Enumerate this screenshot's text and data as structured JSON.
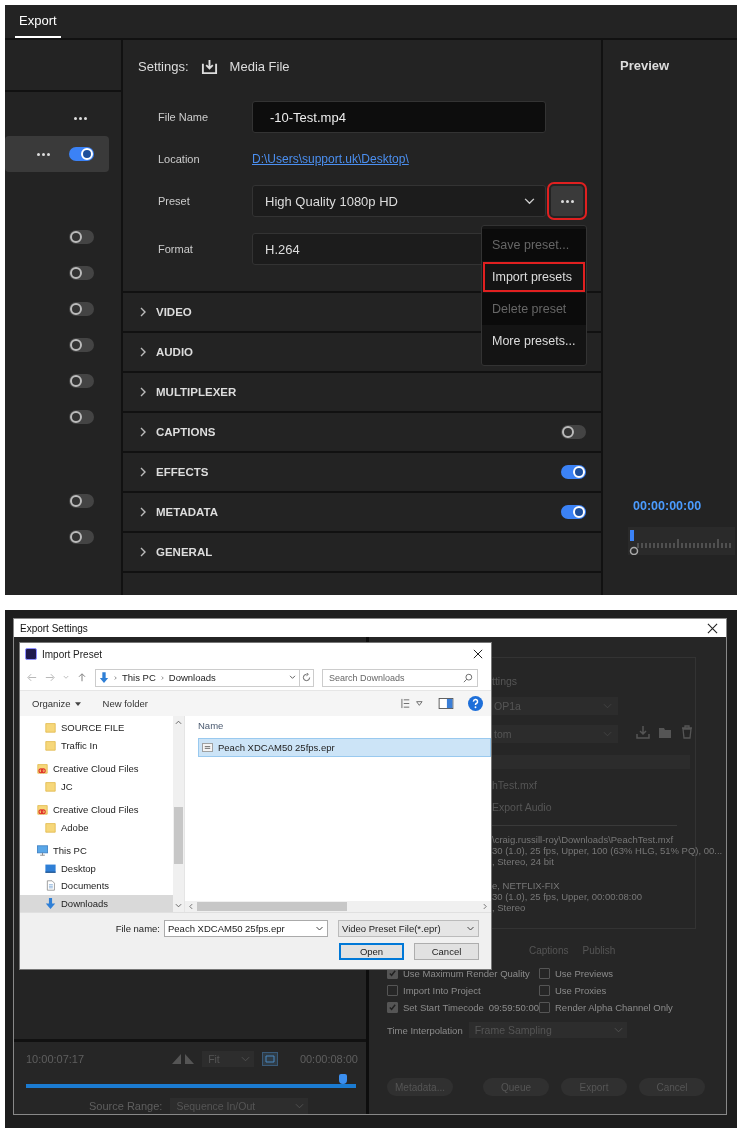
{
  "export_panel": {
    "tabs": [
      {
        "label": "Export",
        "selected": true
      }
    ],
    "targets_top": [
      {
        "kind": "menu",
        "selected": false
      },
      {
        "kind": "menu-toggle",
        "selected": true,
        "on": true
      },
      {
        "kind": "toggle",
        "selected": false,
        "on": false
      },
      {
        "kind": "toggle",
        "selected": false,
        "on": false
      },
      {
        "kind": "toggle",
        "selected": false,
        "on": false
      },
      {
        "kind": "toggle",
        "selected": false,
        "on": false
      },
      {
        "kind": "toggle",
        "selected": false,
        "on": false
      },
      {
        "kind": "toggle",
        "selected": false,
        "on": false
      }
    ],
    "targets_bottom": [
      {
        "kind": "toggle",
        "selected": false,
        "on": false
      },
      {
        "kind": "toggle",
        "selected": false,
        "on": false
      }
    ],
    "settings": {
      "label": "Settings:",
      "destination": "Media File"
    },
    "fields": [
      {
        "kind": "input",
        "label": "File Name",
        "value": "-10-Test.mp4"
      },
      {
        "kind": "link",
        "label": "Location",
        "value": "D:\\Users\\support.uk\\Desktop\\"
      },
      {
        "kind": "select-more",
        "label": "Preset",
        "value": "High Quality 1080p HD",
        "more_highlighted": true
      },
      {
        "kind": "select",
        "label": "Format",
        "value": "H.264"
      }
    ],
    "preset_menu": [
      {
        "label": "Save preset...",
        "disabled": true,
        "highlighted": false
      },
      {
        "label": "Import presets",
        "disabled": false,
        "highlighted": true
      },
      {
        "label": "Delete preset",
        "disabled": true,
        "highlighted": false
      },
      {
        "label": "More presets...",
        "disabled": false,
        "highlighted": false
      }
    ],
    "sections": [
      {
        "label": "VIDEO",
        "kind": "plain"
      },
      {
        "label": "AUDIO",
        "kind": "plain"
      },
      {
        "label": "MULTIPLEXER",
        "kind": "plain"
      },
      {
        "label": "CAPTIONS",
        "kind": "toggle",
        "on": false
      },
      {
        "label": "EFFECTS",
        "kind": "toggle",
        "on": true
      },
      {
        "label": "METADATA",
        "kind": "toggle",
        "on": true
      },
      {
        "label": "GENERAL",
        "kind": "plain"
      }
    ],
    "preview": {
      "title": "Preview",
      "timecode": "00:00:00:00"
    }
  },
  "export_settings_window": {
    "title": "Export Settings",
    "fragments": [
      "ttings",
      "OP1a",
      "tom",
      "hTest.mxf",
      "Export Audio"
    ],
    "summary_lines": [
      "\\craig.russill-roy\\Downloads\\PeachTest.mxf",
      "30 (1.0), 25 fps, Upper, 100 (63% HLG, 51% PQ), 00...",
      ", Stereo, 24 bit",
      "e, NETFLIX-FIX",
      "30 (1.0), 25 fps, Upper, 00:00:08:00",
      ", Stereo"
    ],
    "tabs": [
      "Captions",
      "Publish"
    ],
    "options": [
      {
        "label": "Use Maximum Render Quality",
        "checked": true
      },
      {
        "label": "Use Previews",
        "checked": false
      },
      {
        "label": "Import Into Project",
        "checked": false
      },
      {
        "label": "Use Proxies",
        "checked": false
      },
      {
        "label": "Set Start Timecode",
        "checked": true,
        "value": "09:59:50:00"
      },
      {
        "label": "Render Alpha Channel Only",
        "checked": false
      }
    ],
    "time_interpolation": {
      "label": "Time Interpolation",
      "value": "Frame Sampling"
    },
    "buttons": [
      "Metadata...",
      "Queue",
      "Export",
      "Cancel"
    ],
    "source": {
      "current_time": "10:00:07:17",
      "zoom": "Fit",
      "duration": "00:00:08:00",
      "range_label": "Source Range:",
      "range": "Sequence In/Out",
      "level": 0.96
    }
  },
  "import_dialog": {
    "title": "Import Preset",
    "path": [
      "This PC",
      "Downloads"
    ],
    "search_placeholder": "Search Downloads",
    "toolbar": [
      "Organize",
      "New folder"
    ],
    "tree": [
      {
        "label": "SOURCE FILE",
        "kind": "folder",
        "selected": false
      },
      {
        "label": "Traffic In",
        "kind": "folder",
        "selected": false
      },
      {
        "label": "Creative Cloud Files",
        "kind": "cloud",
        "selected": false,
        "children": [
          {
            "label": "JC",
            "kind": "folder",
            "selected": false
          }
        ]
      },
      {
        "label": "Creative Cloud Files",
        "kind": "cloud",
        "selected": false,
        "children": [
          {
            "label": "Adobe",
            "kind": "folder",
            "selected": false
          }
        ]
      },
      {
        "label": "This PC",
        "kind": "pc",
        "selected": false,
        "children": [
          {
            "label": "Desktop",
            "kind": "desktop",
            "selected": false
          },
          {
            "label": "Documents",
            "kind": "documents",
            "selected": false
          },
          {
            "label": "Downloads",
            "kind": "downloads",
            "selected": true
          }
        ]
      }
    ],
    "column": "Name",
    "files": [
      {
        "name": "Peach XDCAM50 25fps.epr",
        "selected": true
      }
    ],
    "file_name_label": "File name:",
    "file_name": "Peach XDCAM50 25fps.epr",
    "file_type": "Video Preset File(*.epr)",
    "buttons": [
      {
        "label": "Open",
        "kind": "default"
      },
      {
        "label": "Cancel",
        "kind": "normal"
      }
    ]
  }
}
